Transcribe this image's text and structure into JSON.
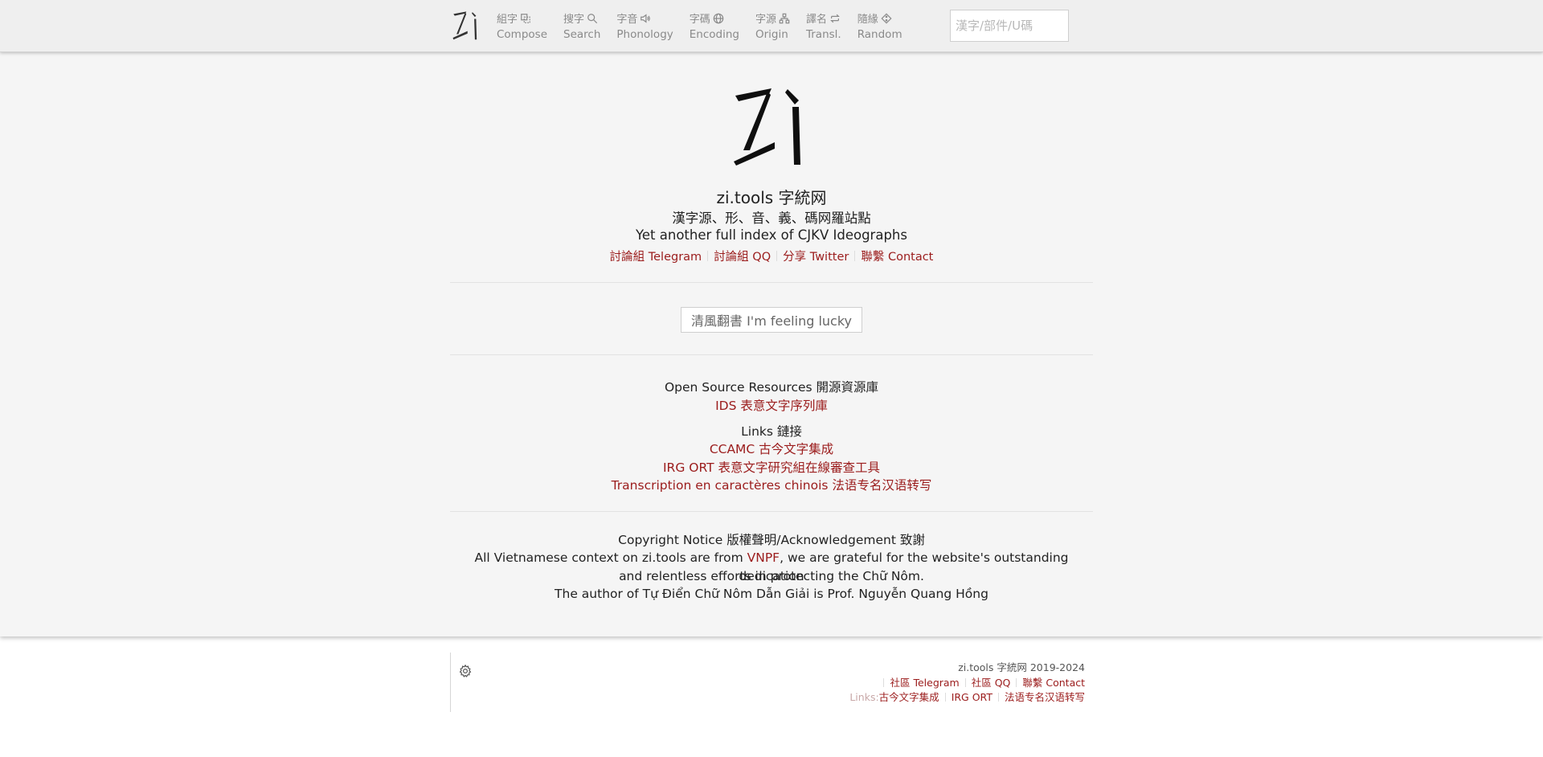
{
  "nav": {
    "items": [
      {
        "cjk": "組字",
        "label": "Compose"
      },
      {
        "cjk": "搜字",
        "label": "Search"
      },
      {
        "cjk": "字音",
        "label": "Phonology"
      },
      {
        "cjk": "字碼",
        "label": "Encoding"
      },
      {
        "cjk": "字源",
        "label": "Origin"
      },
      {
        "cjk": "譯名",
        "label": "Transl."
      },
      {
        "cjk": "隨緣",
        "label": "Random"
      }
    ],
    "search_placeholder": "漢字/部件/U碼"
  },
  "hero": {
    "title": "zi.tools 字統网",
    "subtitle_cjk": "漢字源、形、音、義、碼网羅站點",
    "subtitle_en": "Yet another full index of CJKV Ideographs",
    "links": [
      "討論組 Telegram",
      "討論組 QQ",
      "分享 Twitter",
      "聯繫 Contact"
    ]
  },
  "lucky_button": "清風翻書 I'm feeling lucky",
  "resources": {
    "heading": "Open Source Resources 開源資源庫",
    "items": [
      "IDS 表意文字序列庫"
    ]
  },
  "links_section": {
    "heading": "Links 鏈接",
    "items": [
      "CCAMC 古今文字集成",
      "IRG ORT 表意文字研究組在線審查工具",
      "Transcription en caractères chinois 法语专名汉语转写"
    ]
  },
  "copyright": {
    "heading": "Copyright Notice 版權聲明/Acknowledgement 致謝",
    "line1_pre": "All Vietnamese context on zi.tools are from ",
    "line1_link": "VNPF",
    "line1_post": ", we are grateful for the website's outstanding dedication",
    "line2": "and relentless efforts in protecting the Chữ Nôm.",
    "line3": "The author of Tự Điển Chữ Nôm Dẫn Giải is Prof. Nguyễn Quang Hồng"
  },
  "footer": {
    "copyright": "zi.tools 字統网 2019-2024",
    "social_links": [
      "社區 Telegram",
      "社區 QQ",
      "聯繫 Contact"
    ],
    "links_label": "Links:",
    "links": [
      "古今文字集成",
      "IRG ORT",
      "法语专名汉语转写"
    ]
  },
  "colors": {
    "accent": "#9b1c1c",
    "nav_text": "#8a8a8a",
    "main_bg": "#f5f5f5",
    "topbar_bg": "#efefef"
  },
  "icons": [
    "zi-logo",
    "compose-icon",
    "search-icon",
    "speaker-icon",
    "globe-icon",
    "tree-icon",
    "swap-icon",
    "dice-icon",
    "gear-icon"
  ]
}
